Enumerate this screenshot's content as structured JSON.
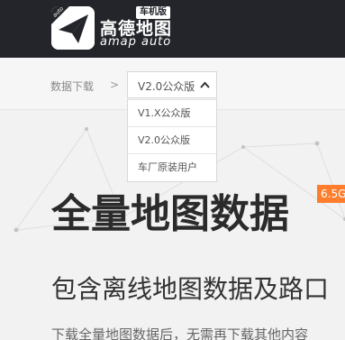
{
  "header": {
    "logo_badge": "auto",
    "brand_cn": "高德地图",
    "brand_en": "amap auto",
    "edition_tag": "车机版"
  },
  "breadcrumb": {
    "root": "数据下载",
    "separator": ">",
    "selected_version": "V2.0公众版"
  },
  "dropdown": {
    "options": [
      "V1.X公众版",
      "V2.0公众版",
      "车厂原装用户"
    ]
  },
  "hero": {
    "title": "全量地图数据",
    "version_badge": "6.5G",
    "subtitle": "包含离线地图数据及路口",
    "description": "下载全量地图数据后，无需再下载其他内容"
  },
  "colors": {
    "header_bg": "#23252a",
    "badge_orange": "#ff7e2e"
  }
}
